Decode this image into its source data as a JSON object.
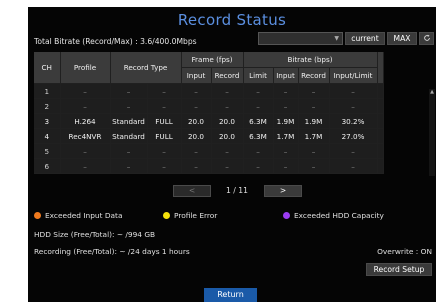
{
  "title": "Record Status",
  "bitrate_label": "Total Bitrate (Record/Max) : 3.6/400.0Mbps",
  "toolbar": {
    "current_label": "current",
    "max_label": "MAX",
    "refresh_icon": "refresh-icon"
  },
  "table": {
    "headers": {
      "ch": "CH",
      "profile": "Profile",
      "record_type": "Record Type",
      "frame_group": "Frame (fps)",
      "bitrate_group": "Bitrate (bps)",
      "frame_input": "Input",
      "frame_record": "Record",
      "limit": "Limit",
      "bit_input": "Input",
      "bit_record": "Record",
      "input_limit": "Input/Limit"
    },
    "rows": [
      {
        "ch": "1",
        "profile": "–",
        "rtype": "–",
        "rmode": "–",
        "f_in": "–",
        "f_rec": "–",
        "limit": "–",
        "b_in": "–",
        "b_rec": "–",
        "ratio": "–"
      },
      {
        "ch": "2",
        "profile": "–",
        "rtype": "–",
        "rmode": "–",
        "f_in": "–",
        "f_rec": "–",
        "limit": "–",
        "b_in": "–",
        "b_rec": "–",
        "ratio": "–"
      },
      {
        "ch": "3",
        "profile": "H.264",
        "rtype": "Standard",
        "rmode": "FULL",
        "f_in": "20.0",
        "f_rec": "20.0",
        "limit": "6.3M",
        "b_in": "1.9M",
        "b_rec": "1.9M",
        "ratio": "30.2%"
      },
      {
        "ch": "4",
        "profile": "Rec4NVR",
        "rtype": "Standard",
        "rmode": "FULL",
        "f_in": "20.0",
        "f_rec": "20.0",
        "limit": "6.3M",
        "b_in": "1.7M",
        "b_rec": "1.7M",
        "ratio": "27.0%"
      },
      {
        "ch": "5",
        "profile": "–",
        "rtype": "–",
        "rmode": "–",
        "f_in": "–",
        "f_rec": "–",
        "limit": "–",
        "b_in": "–",
        "b_rec": "–",
        "ratio": "–"
      },
      {
        "ch": "6",
        "profile": "–",
        "rtype": "–",
        "rmode": "–",
        "f_in": "–",
        "f_rec": "–",
        "limit": "–",
        "b_in": "–",
        "b_rec": "–",
        "ratio": "–"
      }
    ]
  },
  "pager": {
    "prev": "<",
    "next": ">",
    "page_info": "1 / 11"
  },
  "legend": {
    "input": {
      "label": "Exceeded Input Data",
      "color": "#f07a1e"
    },
    "profile": {
      "label": "Profile Error",
      "color": "#f5e20b"
    },
    "hdd": {
      "label": "Exceeded HDD Capacity",
      "color": "#9b3cf2"
    }
  },
  "info": {
    "hdd": "HDD Size  (Free/Total):  ~ /994 GB",
    "recording": "Recording (Free/Total):  ~ /24 days 1 hours",
    "overwrite": "Overwrite : ON"
  },
  "buttons": {
    "record_setup": "Record Setup",
    "return": "Return"
  }
}
